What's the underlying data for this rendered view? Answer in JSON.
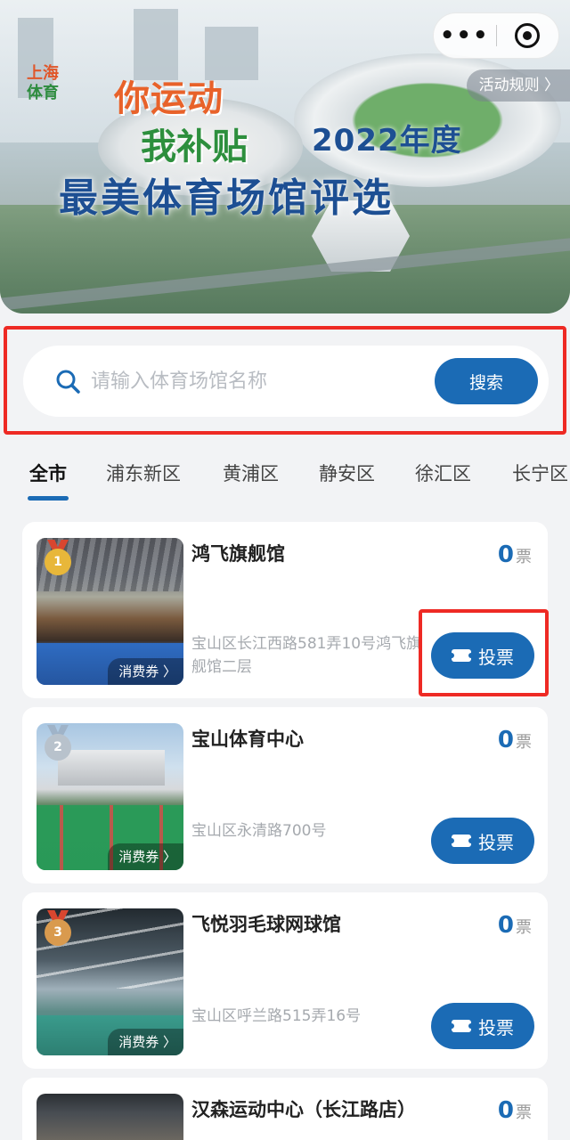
{
  "banner": {
    "logo_line1": "上海",
    "logo_line2": "体育",
    "slogan_line1": "你运动",
    "slogan_line2": "我补贴",
    "year_text": "2022年度",
    "title": "最美体育场馆评选",
    "rules_label": "活动规则 〉"
  },
  "capsule": {
    "more_label": "•••"
  },
  "search": {
    "placeholder": "请输入体育场馆名称",
    "value": "",
    "button_label": "搜索",
    "icon": "search-icon"
  },
  "tabs": [
    {
      "label": "全市",
      "active": true
    },
    {
      "label": "浦东新区",
      "active": false
    },
    {
      "label": "黄浦区",
      "active": false
    },
    {
      "label": "静安区",
      "active": false
    },
    {
      "label": "徐汇区",
      "active": false
    },
    {
      "label": "长宁区",
      "active": false
    }
  ],
  "venues": [
    {
      "rank": "1",
      "medal_color": "#e8b73a",
      "name": "鸿飞旗舰馆",
      "votes": "0",
      "votes_unit": "票",
      "address": "宝山区长江西路581弄10号鸿飞旗舰馆二层",
      "voucher_label": "消费券 〉",
      "vote_label": "投票"
    },
    {
      "rank": "2",
      "medal_color": "#b8c2cc",
      "name": "宝山体育中心",
      "votes": "0",
      "votes_unit": "票",
      "address": "宝山区永清路700号",
      "voucher_label": "消费券 〉",
      "vote_label": "投票"
    },
    {
      "rank": "3",
      "medal_color": "#d99a4e",
      "name": "飞悦羽毛球网球馆",
      "votes": "0",
      "votes_unit": "票",
      "address": "宝山区呼兰路515弄16号",
      "voucher_label": "消费券 〉",
      "vote_label": "投票"
    },
    {
      "rank": "",
      "medal_color": "",
      "name": "汉森运动中心（长江路店）",
      "votes": "0",
      "votes_unit": "票",
      "address": "",
      "voucher_label": "",
      "vote_label": ""
    }
  ],
  "colors": {
    "accent": "#1b6bb5",
    "highlight": "#ee2a24",
    "background": "#f2f3f5"
  }
}
